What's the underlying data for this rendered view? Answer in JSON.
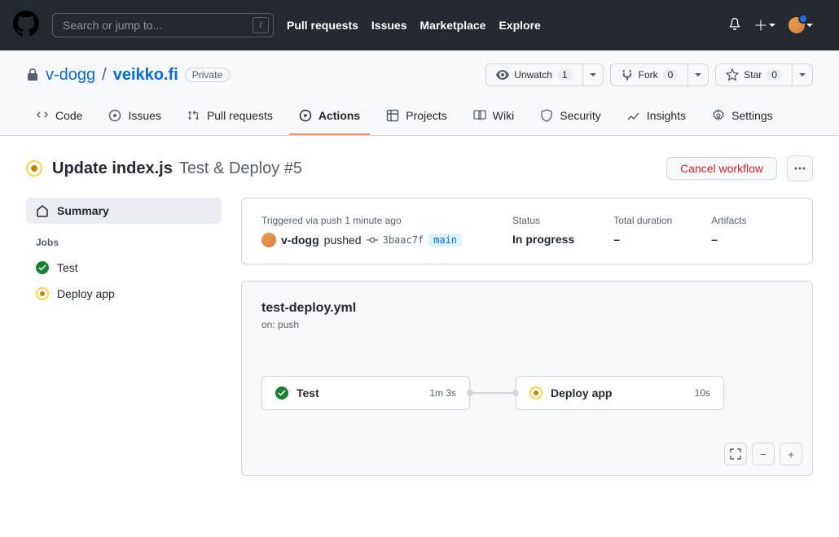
{
  "topbar": {
    "search_placeholder": "Search or jump to...",
    "nav": [
      "Pull requests",
      "Issues",
      "Marketplace",
      "Explore"
    ]
  },
  "repo": {
    "owner": "v-dogg",
    "name": "veikko.fi",
    "visibility": "Private",
    "actions": {
      "watch_label": "Unwatch",
      "watch_count": "1",
      "fork_label": "Fork",
      "fork_count": "0",
      "star_label": "Star",
      "star_count": "0"
    },
    "tabs": [
      "Code",
      "Issues",
      "Pull requests",
      "Actions",
      "Projects",
      "Wiki",
      "Security",
      "Insights",
      "Settings"
    ],
    "active_tab": "Actions"
  },
  "run": {
    "commit_message": "Update index.js",
    "workflow_run": "Test & Deploy #5",
    "cancel_label": "Cancel workflow"
  },
  "sidebar": {
    "summary_label": "Summary",
    "jobs_heading": "Jobs",
    "jobs": [
      {
        "name": "Test",
        "status": "success"
      },
      {
        "name": "Deploy app",
        "status": "in_progress"
      }
    ]
  },
  "summary": {
    "trigger_label": "Triggered via push 1 minute ago",
    "actor": "v-dogg",
    "action_text": "pushed",
    "commit_sha": "3baac7f",
    "branch": "main",
    "status_label": "Status",
    "status_value": "In progress",
    "duration_label": "Total duration",
    "duration_value": "–",
    "artifacts_label": "Artifacts",
    "artifacts_value": "–"
  },
  "graph": {
    "file": "test-deploy.yml",
    "trigger": "on: push",
    "nodes": [
      {
        "name": "Test",
        "status": "success",
        "time": "1m 3s"
      },
      {
        "name": "Deploy app",
        "status": "in_progress",
        "time": "10s"
      }
    ]
  }
}
